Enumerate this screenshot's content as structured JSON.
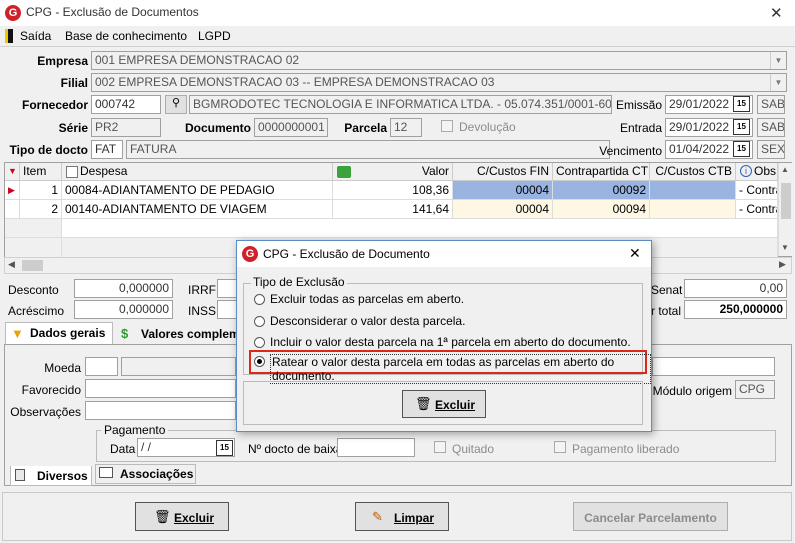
{
  "window": {
    "title": "CPG - Exclusão de Documentos",
    "close": "✕"
  },
  "menu": [
    "Saída",
    "Base de conhecimento",
    "LGPD"
  ],
  "form": {
    "empresa_label": "Empresa",
    "empresa": "001 EMPRESA DEMONSTRACAO 02",
    "filial_label": "Filial",
    "filial": "002 EMPRESA DEMONSTRACAO 03 -- EMPRESA DEMONSTRACAO 03",
    "fornecedor_label": "Fornecedor",
    "fornecedor_code": "000742",
    "fornecedor_name": "BGMRODOTEC TECNOLOGIA E INFORMATICA LTDA. - 05.074.351/0001-60",
    "emissao_label": "Emissão",
    "emissao": "29/01/2022",
    "emissao_dow": "SAB",
    "serie_label": "Série",
    "serie": "PR2",
    "documento_label": "Documento",
    "documento": "0000000001",
    "parcela_label": "Parcela",
    "parcela": "12",
    "devolucao_label": "Devolução",
    "entrada_label": "Entrada",
    "entrada": "29/01/2022",
    "entrada_dow": "SAB",
    "tipo_label": "Tipo de docto",
    "tipo_code": "FAT",
    "tipo_name": "FATURA",
    "vencimento_label": "Vencimento",
    "vencimento": "01/04/2022",
    "vencimento_dow": "SEX"
  },
  "grid": {
    "headers": [
      "Item",
      "Despesa",
      "Valor",
      "C/Custos FIN",
      "Contrapartida CTB",
      "C/Custos CTB",
      "Obs"
    ],
    "rows": [
      [
        "1",
        "00084-ADIANTAMENTO DE PEDAGIO",
        "108,36",
        "00004",
        "00092",
        "",
        "- Contra"
      ],
      [
        "2",
        "00140-ADIANTAMENTO DE VIAGEM",
        "141,64",
        "00004",
        "00094",
        "",
        "- Contra"
      ]
    ]
  },
  "totals": {
    "desconto_label": "Desconto",
    "desconto": "0,000000",
    "acrescimo_label": "Acréscimo",
    "acrescimo": "0,000000",
    "irrf_label": "IRRF",
    "inss_label": "INSS",
    "senat_label": "Senat",
    "senat": "0,00",
    "total_label": "r total",
    "total": "250,000000"
  },
  "tabs": {
    "dados_gerais": "Dados gerais",
    "valores": "Valores complem",
    "diversos": "Diversos",
    "associacoes": "Associações"
  },
  "general": {
    "moeda_label": "Moeda",
    "favorecido_label": "Favorecido",
    "observacoes_label": "Observações",
    "modulo_label": "Módulo origem",
    "modulo": "CPG",
    "pagamento_label": "Pagamento",
    "data_label": "Data",
    "data": " /  /",
    "nbaixa_label": "Nº docto de baixa",
    "quitado_label": "Quitado",
    "liberado_label": "Pagamento liberado"
  },
  "dialog": {
    "title": "CPG - Exclusão de Documento",
    "close": "✕",
    "group": "Tipo de Exclusão",
    "options": [
      "Excluir todas as parcelas em aberto.",
      "Desconsiderar o valor desta  parcela.",
      "Incluir o valor desta parcela na 1ª parcela em aberto do documento.",
      "Ratear o valor desta parcela em todas as parcelas em aberto do documento."
    ],
    "selected": 3,
    "excluir": "Excluir",
    "highlight_color": "#e0261b"
  },
  "bottom": {
    "excluir": "Excluir",
    "limpar": "Limpar",
    "cancelar": "Cancelar Parcelamento"
  }
}
